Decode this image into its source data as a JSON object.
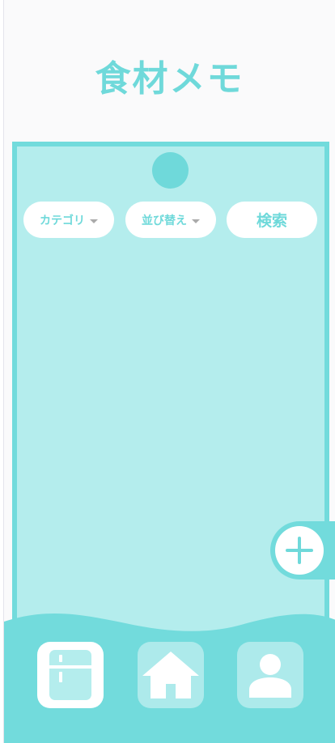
{
  "app": {
    "title": "食材メモ"
  },
  "filters": {
    "category_label": "カテゴリ",
    "sort_label": "並び替え",
    "search_label": "検索"
  },
  "icons": {
    "add": "plus-icon",
    "fridge": "fridge-icon",
    "home": "home-icon",
    "profile": "person-icon"
  },
  "colors": {
    "accent": "#6fd9da",
    "board_fill": "#b4eded",
    "background": "#fafafb",
    "white": "#ffffff"
  },
  "bottom_nav": {
    "selected": "fridge"
  }
}
